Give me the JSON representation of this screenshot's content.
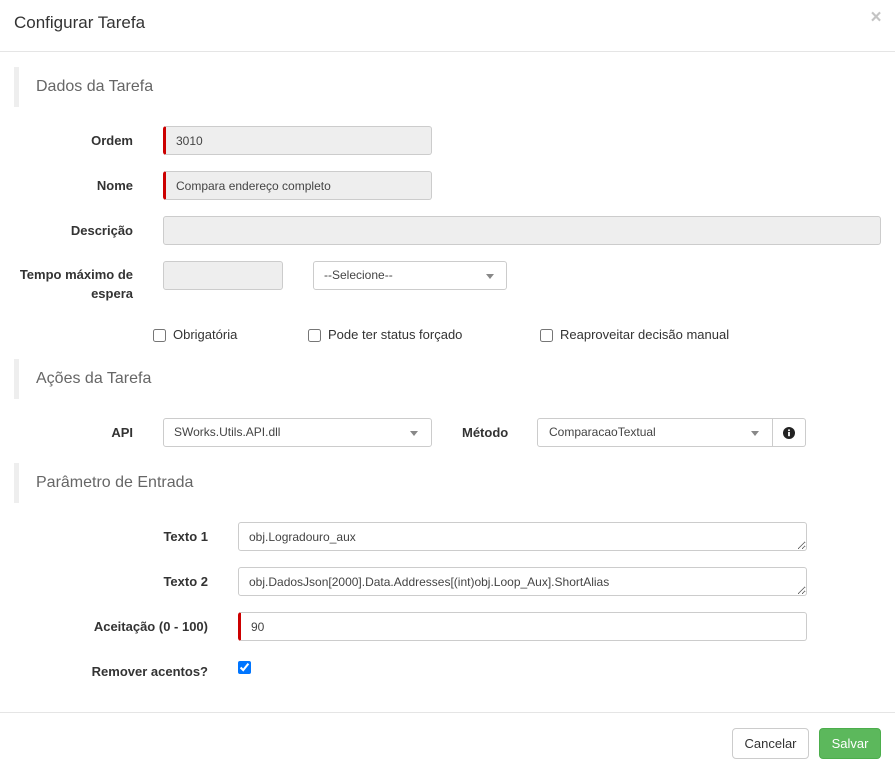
{
  "modal": {
    "title": "Configurar Tarefa",
    "close_label": "×"
  },
  "dados_tarefa": {
    "heading": "Dados da Tarefa",
    "ordem": {
      "label": "Ordem",
      "value": "3010"
    },
    "nome": {
      "label": "Nome",
      "value": "Compara endereço completo"
    },
    "descricao": {
      "label": "Descrição",
      "value": ""
    },
    "tempo_maximo": {
      "label": "Tempo máximo de espera",
      "value": "",
      "unidade_selected": "--Selecione--"
    },
    "options": [
      {
        "label": "Obrigatória",
        "checked": false
      },
      {
        "label": "Pode ter status forçado",
        "checked": false
      },
      {
        "label": "Reaproveitar decisão manual",
        "checked": false
      }
    ]
  },
  "acoes_tarefa": {
    "heading": "Ações da Tarefa",
    "api": {
      "label": "API",
      "selected": "SWorks.Utils.API.dll"
    },
    "metodo": {
      "label": "Método",
      "selected": "ComparacaoTextual",
      "info_icon": "info-circle-icon"
    }
  },
  "parametro_entrada": {
    "heading": "Parâmetro de Entrada",
    "texto1": {
      "label": "Texto 1",
      "value": "obj.Logradouro_aux"
    },
    "texto2": {
      "label": "Texto 2",
      "value": "obj.DadosJson[2000].Data.Addresses[(int)obj.Loop_Aux].ShortAlias"
    },
    "aceitacao": {
      "label": "Aceitação (0 - 100)",
      "value": "90"
    },
    "remover_acentos": {
      "label": "Remover acentos?",
      "checked": true
    }
  },
  "footer": {
    "cancel_label": "Cancelar",
    "save_label": "Salvar"
  },
  "colors": {
    "required_marker": "#cc0000",
    "save_button": "#5cb85c",
    "checkbox_checked": "#0075ff"
  }
}
